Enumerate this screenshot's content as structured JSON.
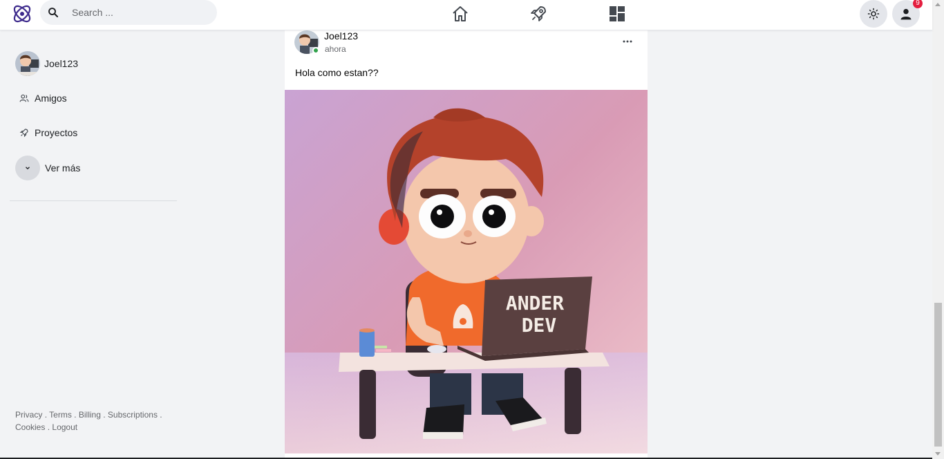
{
  "header": {
    "search_placeholder": "Search ...",
    "notification_count": "9",
    "icons": [
      "logo-icon",
      "search-icon",
      "home-icon",
      "rocket-icon",
      "dashboard-icon",
      "sun-icon",
      "user-icon"
    ]
  },
  "sidebar": {
    "profile_name": "Joel123",
    "items": [
      {
        "label": "Amigos",
        "icon": "friends-icon"
      },
      {
        "label": "Proyectos",
        "icon": "rocket-icon"
      },
      {
        "label": "Ver más",
        "icon": "chevron-down-icon"
      }
    ],
    "footer": {
      "privacy": "Privacy",
      "terms": "Terms",
      "billing": "Billing",
      "subscriptions": "Subscriptions",
      "cookies": "Cookies",
      "logout": "Logout",
      "separator": "."
    }
  },
  "post": {
    "username": "Joel123",
    "time": "ahora",
    "text": "Hola como estan??",
    "image_laptop_text_line1": "ANDER",
    "image_laptop_text_line2": "DEV"
  },
  "colors": {
    "accent": "#5b3fa8",
    "online": "#31a24c",
    "badge": "#e41e3f",
    "background": "#f2f3f5"
  }
}
